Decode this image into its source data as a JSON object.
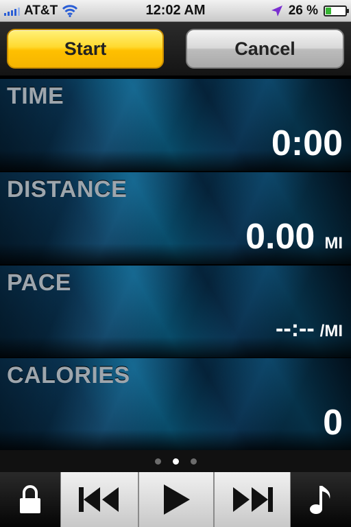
{
  "status_bar": {
    "carrier": "AT&T",
    "time": "12:02 AM",
    "battery_percent": "26 %",
    "battery_level": 0.26
  },
  "buttons": {
    "start_label": "Start",
    "cancel_label": "Cancel"
  },
  "metrics": [
    {
      "label": "TIME",
      "value": "0:00",
      "unit": ""
    },
    {
      "label": "DISTANCE",
      "value": "0.00",
      "unit": "MI"
    },
    {
      "label": "PACE",
      "value": "--:--",
      "unit": "/MI"
    },
    {
      "label": "CALORIES",
      "value": "0",
      "unit": ""
    }
  ],
  "pager": {
    "page_count": 3,
    "active_page": 2
  },
  "toolbar": {
    "icons": [
      "lock-icon",
      "previous-track-icon",
      "play-icon",
      "next-track-icon",
      "music-note-icon"
    ]
  },
  "colors": {
    "start_button": "#ffd92f",
    "cancel_button": "#c8c8c8",
    "label_gray": "#9ea6ad",
    "panel_blue": "#0c6a94"
  }
}
